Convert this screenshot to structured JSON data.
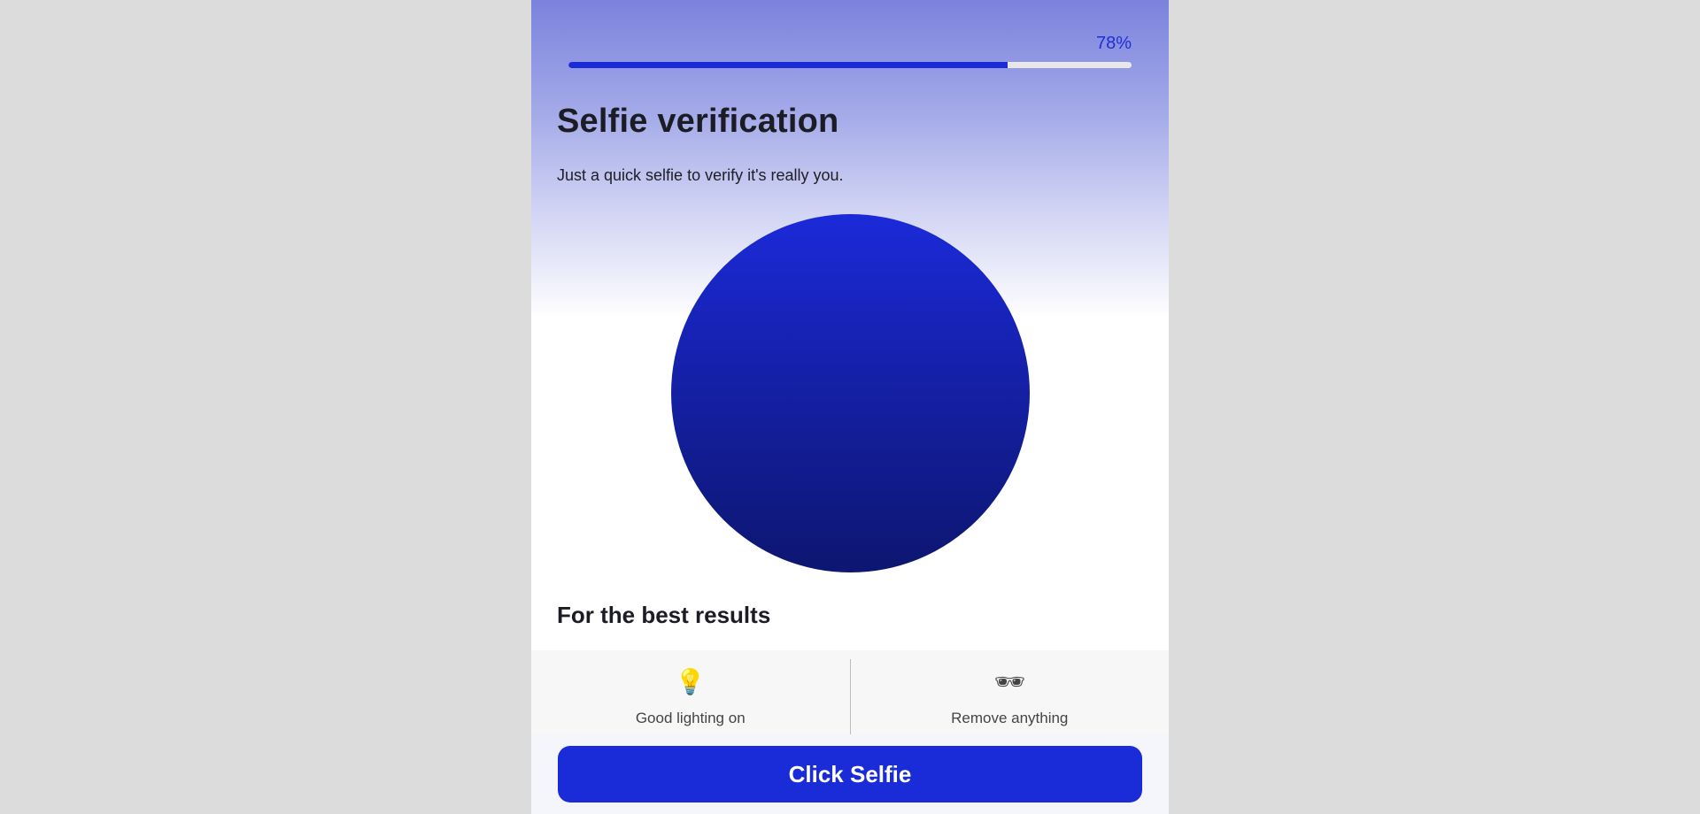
{
  "progress": {
    "label": "78%",
    "value": 0.78
  },
  "header": {
    "title": "Selfie verification",
    "subtitle": "Just a quick selfie to verify it's really you."
  },
  "tips": {
    "title": "For the best results",
    "items": [
      {
        "icon": "lightbulb-icon",
        "glyph": "💡",
        "text": "Good lighting on"
      },
      {
        "icon": "accessories-icon",
        "glyph": "🕶",
        "text": "Remove anything"
      }
    ]
  },
  "footer": {
    "cta_label": "Click Selfie"
  },
  "colors": {
    "accent": "#1a2bd8",
    "circle_top": "#1b2ad9",
    "circle_bottom": "#0d1670"
  }
}
